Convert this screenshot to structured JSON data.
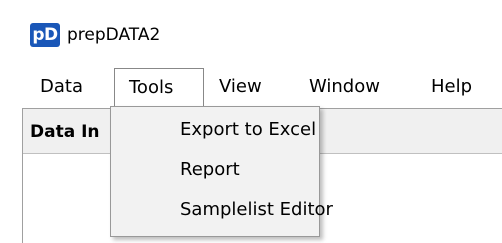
{
  "app": {
    "icon_text": "pD",
    "title": "prepDATA2"
  },
  "menubar": {
    "items": [
      {
        "label": "Data"
      },
      {
        "label": "Tools"
      },
      {
        "label": "View"
      },
      {
        "label": "Window"
      },
      {
        "label": "Help"
      }
    ]
  },
  "tools_menu": {
    "items": [
      {
        "label": "Export to Excel"
      },
      {
        "label": "Report"
      },
      {
        "label": "Samplelist Editor"
      }
    ]
  },
  "panel": {
    "title": "Data In"
  }
}
